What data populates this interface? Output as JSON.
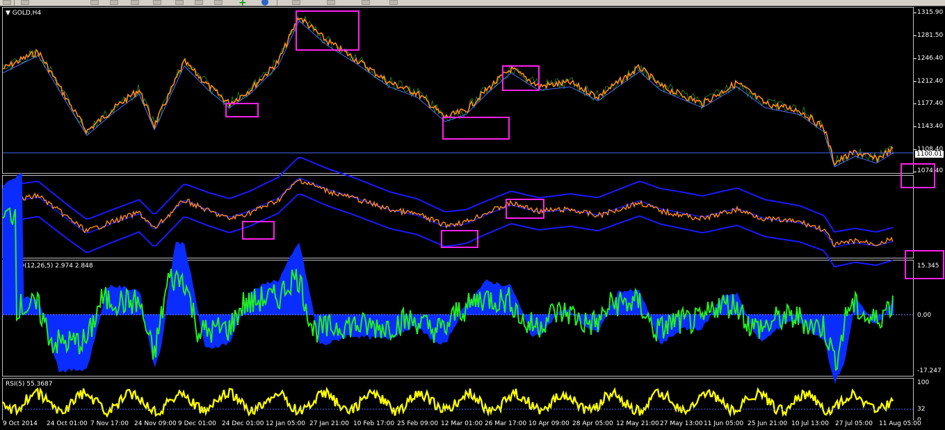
{
  "chart_window": {
    "symbol_label": "GOLD,H4",
    "current_price": "1100.01"
  },
  "price_scale": [
    "1315.90",
    "1281.50",
    "1246.40",
    "1212.40",
    "1177.40",
    "1143.40",
    "1108.40",
    "1074.40"
  ],
  "macd": {
    "label": "MACD(12,26,5) 2.974 2.848",
    "scale": [
      "15.345",
      "0.00",
      "-17.247"
    ]
  },
  "rsi": {
    "label": "RSI(5) 55.3687",
    "scale": [
      "100",
      "32",
      "0"
    ]
  },
  "time_axis": [
    "9 Oct 2014",
    "24 Oct 01:00",
    "7 Nov 17:00",
    "24 Nov 09:00",
    "9 Dec 01:00",
    "24 Dec 01:00",
    "12 Jan 05:00",
    "27 Jan 21:00",
    "10 Feb 17:00",
    "25 Feb 09:00",
    "12 Mar 01:00",
    "26 Mar 17:00",
    "10 Apr 09:00",
    "28 Apr 05:00",
    "12 May 21:00",
    "27 May 13:00",
    "11 Jun 05:00",
    "25 Jun 21:00",
    "10 Jul 13:00",
    "27 Jul 05:00",
    "11 Aug 05:00"
  ],
  "colors": {
    "candles": "#ff8c1a",
    "ma_green": "#1e7a1e",
    "zigzag": "#4a6cff",
    "bands": "#1a1aff",
    "macd_hist": "#0a2cff",
    "macd_signal": "#22ee22",
    "rsi_line": "#ffff00",
    "highlight_box": "#ff22ee"
  }
}
